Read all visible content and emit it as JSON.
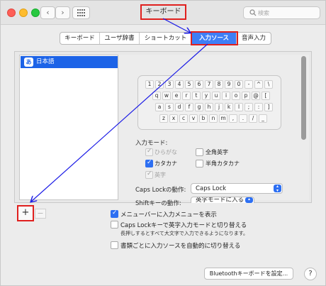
{
  "window": {
    "title": "キーボード",
    "search_placeholder": "検索"
  },
  "tabs": [
    {
      "label": "キーボード",
      "selected": false
    },
    {
      "label": "ユーザ辞書",
      "selected": false
    },
    {
      "label": "ショートカット",
      "selected": false
    },
    {
      "label": "入力ソース",
      "selected": true
    },
    {
      "label": "音声入力",
      "selected": false
    }
  ],
  "sources": [
    {
      "icon_text": "あ",
      "label": "日本語",
      "selected": true
    }
  ],
  "keyboard": {
    "rows": [
      [
        "1",
        "2",
        "3",
        "4",
        "5",
        "6",
        "7",
        "8",
        "9",
        "0",
        "-",
        "^",
        "\\"
      ],
      [
        "q",
        "w",
        "e",
        "r",
        "t",
        "y",
        "u",
        "i",
        "o",
        "p",
        "@",
        "["
      ],
      [
        "a",
        "s",
        "d",
        "f",
        "g",
        "h",
        "j",
        "k",
        "l",
        ";",
        ":",
        "]"
      ],
      [
        "z",
        "x",
        "c",
        "v",
        "b",
        "n",
        "m",
        ",",
        ".",
        "/",
        "_"
      ]
    ]
  },
  "input_mode": {
    "label": "入力モード:",
    "options": [
      {
        "label": "ひらがな",
        "checked": true,
        "disabled": true
      },
      {
        "label": "全角英字",
        "checked": false,
        "disabled": false
      },
      {
        "label": "カタカナ",
        "checked": true,
        "disabled": false
      },
      {
        "label": "半角カタカナ",
        "checked": false,
        "disabled": false
      },
      {
        "label": "英字",
        "checked": true,
        "disabled": true
      }
    ]
  },
  "caps_lock": {
    "label": "Caps Lockの動作:",
    "value": "Caps Lock"
  },
  "shift": {
    "label": "Shiftキーの動作:",
    "value": "英字モードに入る"
  },
  "options": [
    {
      "label": "メニューバーに入力メニューを表示",
      "checked": true
    },
    {
      "label": "Caps Lockキーで英字入力モードと切り替える",
      "checked": false
    },
    {
      "label": "書類ごとに入力ソースを自動的に切り替える",
      "checked": false
    }
  ],
  "caps_note": "長押しするとすべて大文字で入力できるようになります。",
  "buttons": {
    "add": "+",
    "remove": "−",
    "bluetooth": "Bluetoothキーボードを設定...",
    "help": "?"
  },
  "annotation_color": "#1a1ae6",
  "highlight_color": "#e0201e"
}
